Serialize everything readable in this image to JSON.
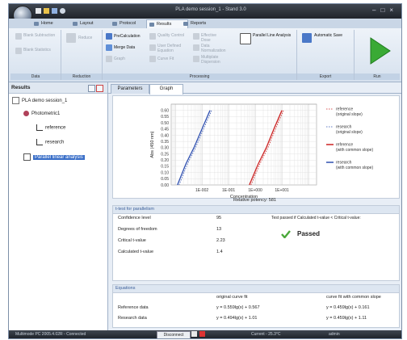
{
  "window": {
    "title": "PLA demo session_1 - Stand 3.0"
  },
  "tabs": [
    "Home",
    "Layout",
    "Protocol",
    "Results",
    "Reports"
  ],
  "ribbon": {
    "groups": [
      {
        "name": "Data",
        "buttons": [
          "Blank Subtraction",
          "Blank Statistics"
        ]
      },
      {
        "name": "Reduction",
        "buttons": [
          "Reduce"
        ]
      },
      {
        "name": "Processing",
        "buttons": [
          "PreCalculation",
          "Merge Data",
          "Graph",
          "Quality Control",
          "User Defined Equation",
          "Curve Fit",
          "Effective Dose",
          "Data Normalization",
          "Multiplate Dispersion",
          "Parallel Line Analysis"
        ]
      },
      {
        "name": "Export",
        "buttons": [
          "Automatic Save"
        ]
      },
      {
        "name": "Run",
        "buttons": []
      }
    ]
  },
  "results_panel": {
    "title": "Results",
    "tree": [
      {
        "label": "PLA demo session_1",
        "level": 0
      },
      {
        "label": "Photometric1",
        "level": 1
      },
      {
        "label": "reference",
        "level": 2
      },
      {
        "label": "research",
        "level": 2
      },
      {
        "label": "Parallel linear analysis",
        "level": 1,
        "selected": true
      }
    ]
  },
  "content_tabs": [
    "Parameters",
    "Graph"
  ],
  "chart_data": {
    "type": "line",
    "ylabel": "Abs (450 nm)",
    "xlabel": "Concentration",
    "x_scale": "log",
    "xlim": [
      0.0007,
      200
    ],
    "ylim": [
      0.0,
      0.65
    ],
    "y_ticks": [
      "0.00",
      "0.05",
      "0.10",
      "0.15",
      "0.20",
      "0.25",
      "0.30",
      "0.35",
      "0.40",
      "0.45",
      "0.50",
      "0.55",
      "0.60"
    ],
    "x_ticks": [
      "1E-002",
      "1E-001",
      "1E+000",
      "1E+001"
    ],
    "grid": true,
    "legend_position": "right",
    "legend": [
      {
        "label": "reference",
        "sub": "(original slope)",
        "color": "#cc2222",
        "dash": true
      },
      {
        "label": "research",
        "sub": "(original slope)",
        "color": "#2f50b0",
        "dash": true
      },
      {
        "label": "reference",
        "sub": "(with common slope)",
        "color": "#cc2222",
        "dash": false
      },
      {
        "label": "research",
        "sub": "(with common slope)",
        "color": "#2f50b0",
        "dash": false
      }
    ],
    "series": [
      {
        "name": "research",
        "color": "#2f50b0",
        "points": [
          [
            0.0012,
            0.0
          ],
          [
            0.0025,
            0.17
          ],
          [
            0.005,
            0.3
          ],
          [
            0.01,
            0.45
          ],
          [
            0.02,
            0.6
          ]
        ]
      },
      {
        "name": "reference",
        "color": "#cc2222",
        "points": [
          [
            0.6,
            0.0
          ],
          [
            1.3,
            0.17
          ],
          [
            2.6,
            0.3
          ],
          [
            5,
            0.45
          ],
          [
            10,
            0.6
          ]
        ]
      }
    ]
  },
  "relative_potency": "Relative potency: 581",
  "ttest": {
    "header": "t-test for parallelism",
    "rows": [
      {
        "label": "Confidence level",
        "value": "95"
      },
      {
        "label": "Degrees of freedom",
        "value": "13"
      },
      {
        "label": "Critical t-value",
        "value": "2.23"
      },
      {
        "label": "Calculated t-value",
        "value": "1.4"
      }
    ],
    "rule": "Test passed if Calculated t-value < Critical t-value:",
    "result": "Passed"
  },
  "equations": {
    "header": "Equations",
    "col1": "original curve fit",
    "col2": "curve fit with common slope",
    "rows": [
      {
        "label": "Reference data",
        "orig": "y = 0.559lg(x) + 0.567",
        "common": "y = 0.459lg(x) + 0.161"
      },
      {
        "label": "Research data",
        "orig": "y = 0.494lg(x) + 1.01",
        "common": "y = 0.459lg(x) + 1.11"
      }
    ]
  },
  "statusbar": {
    "device": "Multimode PC 2005.4.02R - Connected",
    "disconnect": "Disconnect",
    "current": "Current - 25.3°C",
    "user": "admin"
  }
}
